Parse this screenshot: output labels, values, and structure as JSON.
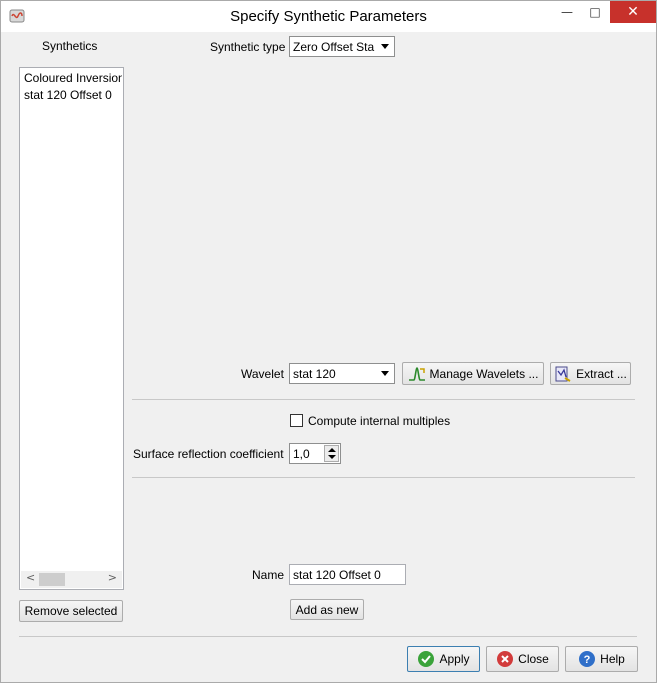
{
  "window": {
    "title": "Specify Synthetic Parameters",
    "minimize_glyph": "—",
    "maximize_glyph": "□",
    "close_glyph": "✕"
  },
  "synthetics": {
    "header": "Synthetics",
    "items": [
      "Coloured Inversion",
      "stat 120 Offset 0"
    ],
    "remove_label": "Remove selected",
    "scroll_left": "<",
    "scroll_right": ">"
  },
  "synthetic_type": {
    "label": "Synthetic type",
    "value": "Zero Offset Sta"
  },
  "wavelet": {
    "label": "Wavelet",
    "value": "stat 120",
    "manage_label": "Manage Wavelets ...",
    "extract_label": "Extract ..."
  },
  "multiples": {
    "checkbox_label": "Compute internal multiples",
    "checked": false
  },
  "surface_reflection": {
    "label": "Surface reflection coefficient",
    "value": "1,0"
  },
  "name": {
    "label": "Name",
    "value": "stat 120 Offset 0",
    "add_label": "Add as new"
  },
  "footer": {
    "apply_label": "Apply",
    "close_label": "Close",
    "help_label": "Help"
  },
  "colors": {
    "close_button": "#c7312b",
    "apply_border": "#3c7fb1"
  },
  "icons": {
    "app": "app-icon",
    "manage_wavelets": "wavelet-icon",
    "extract": "extract-icon",
    "apply": "check-icon",
    "close": "close-circle-icon",
    "help": "help-icon"
  }
}
